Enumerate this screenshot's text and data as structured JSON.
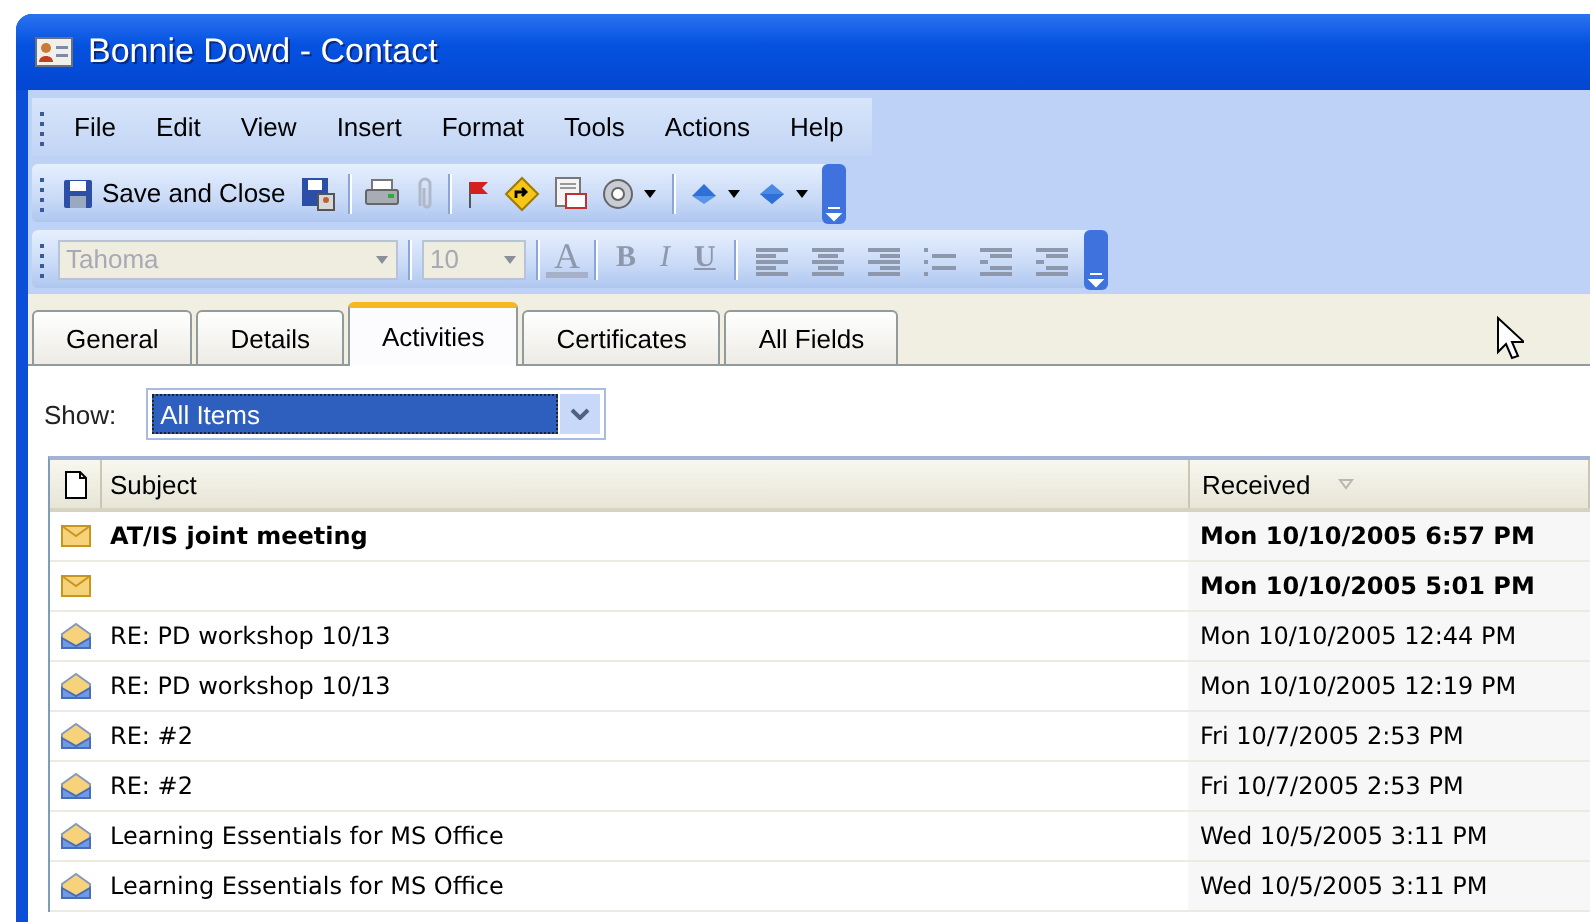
{
  "window": {
    "title": "Bonnie Dowd - Contact"
  },
  "menu": [
    "File",
    "Edit",
    "View",
    "Insert",
    "Format",
    "Tools",
    "Actions",
    "Help"
  ],
  "standard_toolbar": {
    "save_and_close": "Save and Close"
  },
  "formatting_toolbar": {
    "disabled": true,
    "font": "Tahoma",
    "size": "10",
    "font_color": "A",
    "bold": "B",
    "italic": "I",
    "underline": "U"
  },
  "tabs": [
    {
      "label": "General",
      "selected": false
    },
    {
      "label": "Details",
      "selected": false
    },
    {
      "label": "Activities",
      "selected": true
    },
    {
      "label": "Certificates",
      "selected": false
    },
    {
      "label": "All Fields",
      "selected": false
    }
  ],
  "show": {
    "label": "Show:",
    "value": "All Items"
  },
  "table": {
    "columns": [
      "Subject",
      "Received"
    ],
    "rows": [
      {
        "subject": "AT/IS joint meeting",
        "received": "Mon 10/10/2005 6:57 PM",
        "unread": true
      },
      {
        "received": "Mon 10/10/2005 5:01 PM",
        "unread": true
      },
      {
        "subject": "RE: PD workshop 10/13",
        "received": "Mon 10/10/2005 12:44 PM",
        "unread": false
      },
      {
        "subject": "RE: PD workshop 10/13",
        "received": "Mon 10/10/2005 12:19 PM",
        "unread": false
      },
      {
        "subject": "RE: #2",
        "received": "Fri 10/7/2005 2:53 PM",
        "unread": false
      },
      {
        "subject": "RE: #2",
        "received": "Fri 10/7/2005 2:53 PM",
        "unread": false
      },
      {
        "subject": "Learning Essentials for MS Office",
        "received": "Wed 10/5/2005 3:11 PM",
        "unread": false
      },
      {
        "subject": "Learning Essentials for MS Office",
        "received": "Wed 10/5/2005 3:11 PM",
        "unread": false
      }
    ]
  }
}
